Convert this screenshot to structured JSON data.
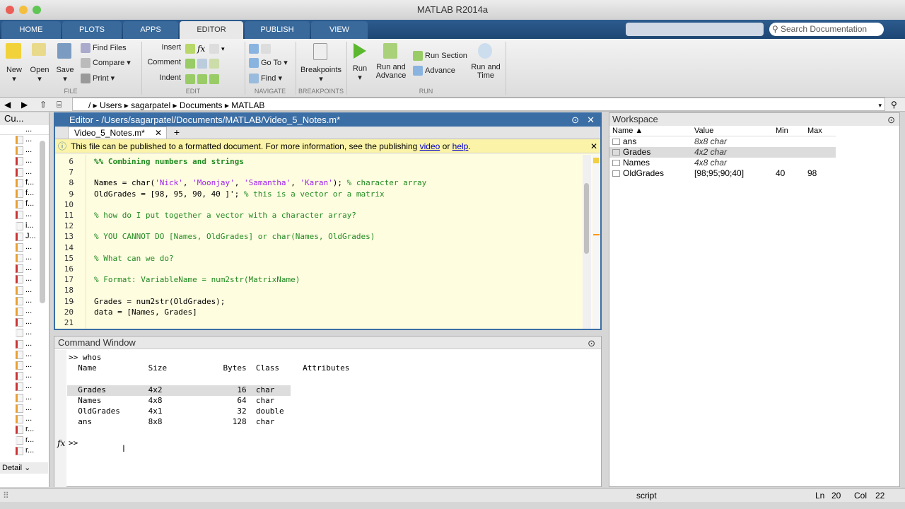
{
  "window": {
    "title": "MATLAB R2014a"
  },
  "tabs": [
    "HOME",
    "PLOTS",
    "APPS",
    "EDITOR",
    "PUBLISH",
    "VIEW"
  ],
  "active_tab": "EDITOR",
  "search": {
    "placeholder": "Search Documentation"
  },
  "ribbon": {
    "file": {
      "new": "New",
      "open": "Open",
      "save": "Save",
      "find_files": "Find Files",
      "compare": "Compare",
      "print": "Print",
      "section": "FILE"
    },
    "edit": {
      "insert": "Insert",
      "comment": "Comment",
      "indent": "Indent",
      "section": "EDIT"
    },
    "navigate": {
      "goto": "Go To",
      "find": "Find",
      "section": "NAVIGATE"
    },
    "breakpoints": {
      "label": "Breakpoints",
      "section": "BREAKPOINTS"
    },
    "run": {
      "run": "Run",
      "run_advance": "Run and Advance",
      "run_section": "Run Section",
      "advance": "Advance",
      "run_time": "Run and Time",
      "section": "RUN"
    }
  },
  "address": [
    "/",
    "Users",
    "sagarpatel",
    "Documents",
    "MATLAB"
  ],
  "current_folder": {
    "title": "Cu...",
    "header": "...",
    "files": [
      "...",
      "...",
      "...",
      "...",
      "f...",
      "f...",
      "f...",
      "...",
      "i...",
      "J...",
      "...",
      "...",
      "...",
      "...",
      "...",
      "...",
      "...",
      "...",
      "...",
      "...",
      "...",
      "...",
      "...",
      "...",
      "...",
      "...",
      "...",
      "r...",
      "r...",
      "r..."
    ],
    "detail": "Detail"
  },
  "editor": {
    "title": "Editor - /Users/sagarpatel/Documents/MATLAB/Video_5_Notes.m*",
    "file_tab": "Video_5_Notes.m*",
    "notice": {
      "text": "This file can be published to a formatted document. For more information, see the publishing",
      "link1": "video",
      "or": "or",
      "link2": "help",
      "end": "."
    },
    "lines": [
      {
        "n": "6",
        "d": "",
        "parts": [
          [
            "cell",
            "%% Combining numbers and strings"
          ]
        ]
      },
      {
        "n": "7",
        "d": "",
        "parts": []
      },
      {
        "n": "8",
        "d": "-",
        "parts": [
          [
            "",
            "Names = char("
          ],
          [
            "st",
            "'Nick'"
          ],
          [
            "",
            ", "
          ],
          [
            "st",
            "'Moonjay'"
          ],
          [
            "",
            ", "
          ],
          [
            "st",
            "'Samantha'"
          ],
          [
            "",
            ", "
          ],
          [
            "st",
            "'Karan'"
          ],
          [
            "",
            "); "
          ],
          [
            "cm",
            "% character array"
          ]
        ]
      },
      {
        "n": "9",
        "d": "-",
        "parts": [
          [
            "",
            "OldGrades = [98, 95, 90, 40 ]'; "
          ],
          [
            "cm",
            "% this is a vector or a matrix"
          ]
        ]
      },
      {
        "n": "10",
        "d": "",
        "parts": []
      },
      {
        "n": "11",
        "d": "",
        "parts": [
          [
            "cm",
            "% how do I put together a vector with a character array?"
          ]
        ]
      },
      {
        "n": "12",
        "d": "",
        "parts": []
      },
      {
        "n": "13",
        "d": "",
        "parts": [
          [
            "cm",
            "% YOU CANNOT DO [Names, OldGrades] or char(Names, OldGrades)"
          ]
        ]
      },
      {
        "n": "14",
        "d": "",
        "parts": []
      },
      {
        "n": "15",
        "d": "",
        "parts": [
          [
            "cm",
            "% What can we do?"
          ]
        ]
      },
      {
        "n": "16",
        "d": "",
        "parts": []
      },
      {
        "n": "17",
        "d": "",
        "parts": [
          [
            "cm",
            "% Format: VariableName = num2str(MatrixName)"
          ]
        ]
      },
      {
        "n": "18",
        "d": "",
        "parts": []
      },
      {
        "n": "19",
        "d": "-",
        "parts": [
          [
            "",
            "Grades = num2str(OldGrades);"
          ]
        ]
      },
      {
        "n": "20",
        "d": "",
        "parts": [
          [
            "",
            "data = [Names, Grades]"
          ]
        ]
      },
      {
        "n": "21",
        "d": "",
        "parts": []
      }
    ]
  },
  "command_window": {
    "title": "Command Window",
    "lines": [
      ">> whos",
      "  Name           Size            Bytes  Class     Attributes",
      "",
      "  Grades         4x2                16  char                ",
      "  Names          4x8                64  char",
      "  OldGrades      4x1                32  double",
      "  ans            8x8               128  char"
    ],
    "prompt": ">>",
    "fx": "fx"
  },
  "workspace": {
    "title": "Workspace",
    "columns": [
      "Name ▲",
      "Value",
      "Min",
      "Max"
    ],
    "rows": [
      {
        "name": "ans",
        "value": "8x8 char",
        "min": "",
        "max": ""
      },
      {
        "name": "Grades",
        "value": "4x2 char",
        "min": "",
        "max": ""
      },
      {
        "name": "Names",
        "value": "4x8 char",
        "min": "",
        "max": ""
      },
      {
        "name": "OldGrades",
        "value": "[98;95;90;40]",
        "min": "40",
        "max": "98"
      }
    ]
  },
  "status": {
    "mode": "script",
    "ln_label": "Ln",
    "ln": "20",
    "col_label": "Col",
    "col": "22"
  }
}
